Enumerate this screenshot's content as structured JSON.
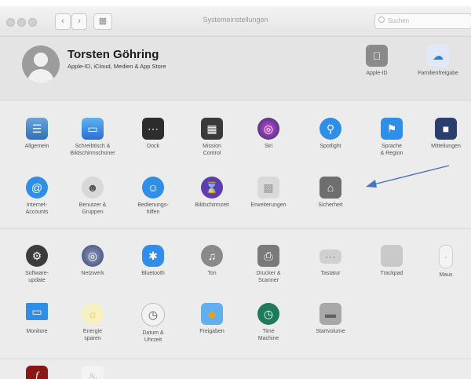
{
  "window": {
    "title": "Systemeinstellungen",
    "search_placeholder": "Suchen"
  },
  "user": {
    "name": "Torsten Göhring",
    "subtitle": "Apple-ID, iCloud, Medien & App Store",
    "panes": [
      {
        "label": "Apple-ID",
        "icon": "apple-id-icon"
      },
      {
        "label": "Familienfreigabe",
        "icon": "family-sharing-icon"
      }
    ]
  },
  "section1": [
    {
      "label": "Allgemein",
      "icon": "general-icon"
    },
    {
      "label": "Schreibtisch &\nBildschirmschoner",
      "icon": "desktop-icon"
    },
    {
      "label": "Dock",
      "icon": "dock-icon"
    },
    {
      "label": "Mission\nControl",
      "icon": "mission-control-icon"
    },
    {
      "label": "Siri",
      "icon": "siri-icon"
    },
    {
      "label": "Spotlight",
      "icon": "spotlight-icon"
    },
    {
      "label": "Sprache\n& Region",
      "icon": "language-region-icon"
    },
    {
      "label": "Mitteilungen",
      "icon": "notifications-icon"
    },
    {
      "label": "Internet-\nAccounts",
      "icon": "internet-accounts-icon"
    },
    {
      "label": "Benutzer &\nGruppen",
      "icon": "users-groups-icon"
    },
    {
      "label": "Bedienungs-\nhilfen",
      "icon": "accessibility-icon"
    },
    {
      "label": "Bildschirmzeit",
      "icon": "screen-time-icon"
    },
    {
      "label": "Erweiterungen",
      "icon": "extensions-icon"
    },
    {
      "label": "Sicherheit",
      "icon": "security-icon"
    }
  ],
  "section2": [
    {
      "label": "Software-\nupdate",
      "icon": "software-update-icon"
    },
    {
      "label": "Netzwerk",
      "icon": "network-icon"
    },
    {
      "label": "Bluetooth",
      "icon": "bluetooth-icon"
    },
    {
      "label": "Ton",
      "icon": "sound-icon"
    },
    {
      "label": "Drucker &\nScanner",
      "icon": "printer-icon"
    },
    {
      "label": "Tastatur",
      "icon": "keyboard-icon"
    },
    {
      "label": "Trackpad",
      "icon": "trackpad-icon"
    },
    {
      "label": "Maus",
      "icon": "mouse-icon"
    },
    {
      "label": "Monitore",
      "icon": "displays-icon"
    },
    {
      "label": "Energie\nsparen",
      "icon": "energy-saver-icon"
    },
    {
      "label": "Datum &\nUhrzeit",
      "icon": "date-time-icon"
    },
    {
      "label": "Freigaben",
      "icon": "sharing-icon"
    },
    {
      "label": "Time\nMachine",
      "icon": "time-machine-icon"
    },
    {
      "label": "Startvolume",
      "icon": "startup-disk-icon"
    }
  ],
  "section3": [
    {
      "label": "",
      "icon": "flash-player-icon"
    },
    {
      "label": "",
      "icon": "java-icon"
    }
  ],
  "colors": {
    "accent": "#3a6fc4",
    "arrow": "#4a73c0",
    "background": "#ececec"
  }
}
